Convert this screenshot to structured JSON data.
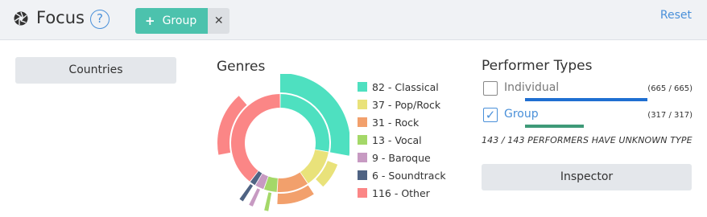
{
  "header": {
    "title": "Focus",
    "help_label": "?",
    "filter_chip": {
      "plus": "+",
      "label": "Group",
      "remove": "✕"
    },
    "reset_label": "Reset"
  },
  "countries_button": "Countries",
  "genres": {
    "title": "Genres",
    "items": [
      {
        "label": "82 - Classical",
        "color": "#4ee0c0"
      },
      {
        "label": "37 - Pop/Rock",
        "color": "#e9e27a"
      },
      {
        "label": "31 - Rock",
        "color": "#f2a06c"
      },
      {
        "label": "13 - Vocal",
        "color": "#a4d868"
      },
      {
        "label": "9 - Baroque",
        "color": "#c79ac2"
      },
      {
        "label": "6 - Soundtrack",
        "color": "#4f6383"
      },
      {
        "label": "116 - Other",
        "color": "#fb8686"
      }
    ]
  },
  "performer_types": {
    "title": "Performer Types",
    "items": [
      {
        "label": "Individual",
        "count": "(665 / 665)",
        "checked": false,
        "bar_color": "#1f6fd1",
        "level": 1.0
      },
      {
        "label": "Group",
        "count": "(317 / 317)",
        "checked": true,
        "bar_color": "#3e9a78",
        "level": 0.48
      }
    ],
    "unknown_text": "143 / 143 PERFORMERS HAVE UNKNOWN TYPE"
  },
  "inspector_button": "Inspector"
}
